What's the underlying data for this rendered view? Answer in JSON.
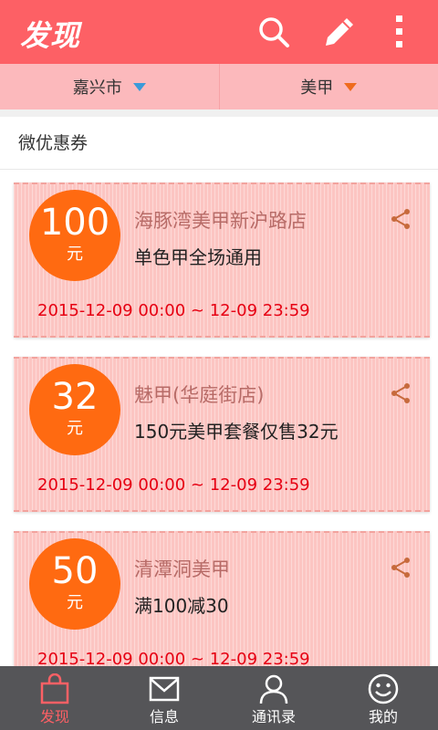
{
  "header": {
    "title": "发现"
  },
  "filters": [
    {
      "label": "嘉兴市"
    },
    {
      "label": "美甲"
    }
  ],
  "section": {
    "title": "微优惠券"
  },
  "coupons": [
    {
      "amount": "100",
      "unit": "元",
      "shop": "海豚湾美甲新沪路店",
      "desc": "单色甲全场通用",
      "time": "2015-12-09 00:00 ~ 12-09 23:59"
    },
    {
      "amount": "32",
      "unit": "元",
      "shop": "魅甲(华庭街店)",
      "desc": "150元美甲套餐仅售32元",
      "time": "2015-12-09 00:00 ~ 12-09 23:59"
    },
    {
      "amount": "50",
      "unit": "元",
      "shop": "清潭洞美甲",
      "desc": "满100减30",
      "time": "2015-12-09 00:00 ~ 12-09 23:59"
    }
  ],
  "tabs": [
    {
      "label": "发现",
      "icon": "bag-icon"
    },
    {
      "label": "信息",
      "icon": "mail-icon"
    },
    {
      "label": "通讯录",
      "icon": "contact-icon"
    },
    {
      "label": "我的",
      "icon": "smiley-icon"
    }
  ],
  "colors": {
    "accent": "#fd6065",
    "badge": "#ff6a11",
    "time": "#e60012",
    "tabbar": "#555558"
  }
}
